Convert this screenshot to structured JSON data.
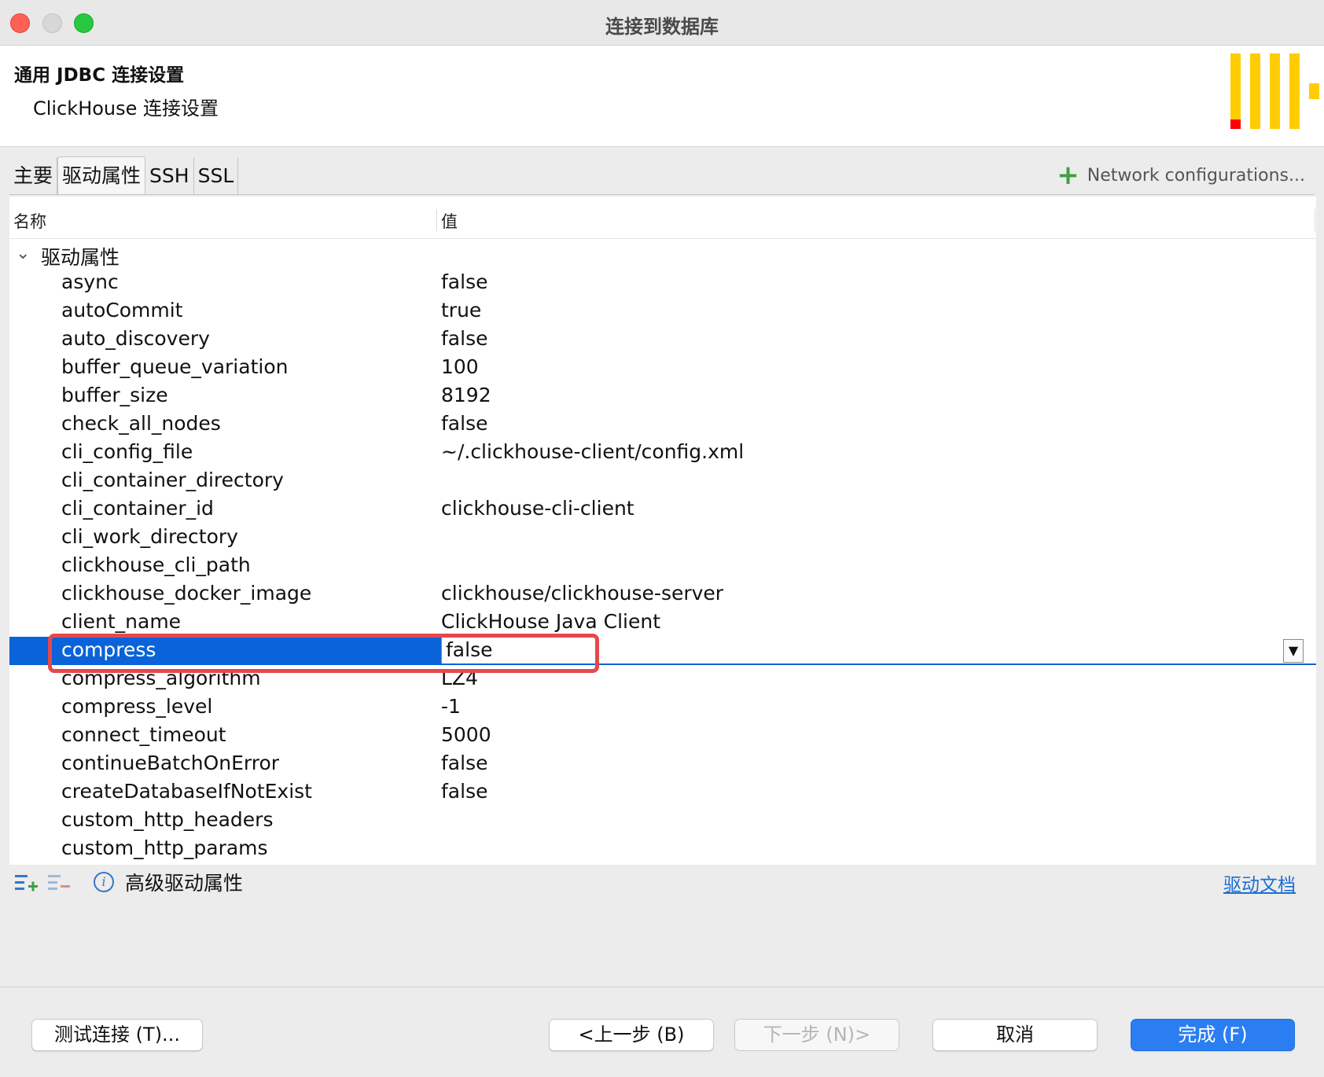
{
  "window": {
    "title": "连接到数据库"
  },
  "header": {
    "title": "通用 JDBC 连接设置",
    "subtitle": "ClickHouse 连接设置",
    "logo_icon": "clickhouse-logo"
  },
  "tabs": [
    {
      "label": "主要",
      "active": false
    },
    {
      "label": "驱动属性",
      "active": true
    },
    {
      "label": "SSH",
      "active": false
    },
    {
      "label": "SSL",
      "active": false
    }
  ],
  "network_config": {
    "label": "Network configurations...",
    "icon": "plus-icon"
  },
  "table": {
    "col_name": "名称",
    "col_value": "值",
    "group_label": "驱动属性",
    "rows": [
      {
        "name": "async",
        "value": "false"
      },
      {
        "name": "autoCommit",
        "value": "true"
      },
      {
        "name": "auto_discovery",
        "value": "false"
      },
      {
        "name": "buffer_queue_variation",
        "value": "100"
      },
      {
        "name": "buffer_size",
        "value": "8192"
      },
      {
        "name": "check_all_nodes",
        "value": "false"
      },
      {
        "name": "cli_config_file",
        "value": "~/.clickhouse-client/config.xml"
      },
      {
        "name": "cli_container_directory",
        "value": ""
      },
      {
        "name": "cli_container_id",
        "value": "clickhouse-cli-client"
      },
      {
        "name": "cli_work_directory",
        "value": ""
      },
      {
        "name": "clickhouse_cli_path",
        "value": ""
      },
      {
        "name": "clickhouse_docker_image",
        "value": "clickhouse/clickhouse-server"
      },
      {
        "name": "client_name",
        "value": "ClickHouse Java Client"
      },
      {
        "name": "compress",
        "value": "false",
        "selected": true
      },
      {
        "name": "compress_algorithm",
        "value": "LZ4"
      },
      {
        "name": "compress_level",
        "value": "-1"
      },
      {
        "name": "connect_timeout",
        "value": "5000"
      },
      {
        "name": "continueBatchOnError",
        "value": "false"
      },
      {
        "name": "createDatabaseIfNotExist",
        "value": "false"
      },
      {
        "name": "custom_http_headers",
        "value": ""
      },
      {
        "name": "custom_http_params",
        "value": ""
      }
    ]
  },
  "toolbar": {
    "advanced_label": "高级驱动属性",
    "doc_link": "驱动文档"
  },
  "buttons": {
    "test": "测试连接 (T)...",
    "back": "<上一步 (B)",
    "next": "下一步 (N)>",
    "cancel": "取消",
    "finish": "完成 (F)"
  },
  "colors": {
    "selection": "#0a63d8",
    "primary_button": "#2b7ef2",
    "highlight_box": "#e5484d",
    "logo_yellow": "#ffcc01",
    "logo_red": "#ff0000"
  }
}
